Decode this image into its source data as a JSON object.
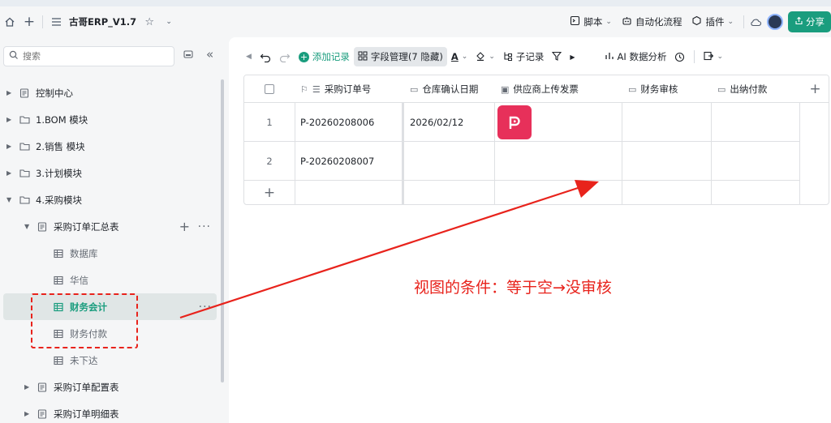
{
  "topbar": {
    "app_title": "古哥ERP_V1.7",
    "script_label": "脚本",
    "automation_label": "自动化流程",
    "plugin_label": "插件",
    "share_label": "分享"
  },
  "sidebar": {
    "search_placeholder": "搜索",
    "items": [
      {
        "label": "控制中心"
      },
      {
        "label": "1.BOM 模块"
      },
      {
        "label": "2.销售 模块"
      },
      {
        "label": "3.计划模块"
      },
      {
        "label": "4.采购模块"
      },
      {
        "label": "采购订单汇总表"
      },
      {
        "label": "数据库"
      },
      {
        "label": "华信"
      },
      {
        "label": "财务会计"
      },
      {
        "label": "财务付款"
      },
      {
        "label": "未下达"
      },
      {
        "label": "采购订单配置表"
      },
      {
        "label": "采购订单明细表"
      }
    ]
  },
  "toolbar": {
    "add_record": "添加记录",
    "field_manage": "字段管理(7 隐藏)",
    "sub_record": "子记录",
    "ai_analysis": "AI 数据分析"
  },
  "table": {
    "columns": [
      "采购订单号",
      "仓库确认日期",
      "供应商上传发票",
      "财务审核",
      "出纳付款"
    ],
    "rows": [
      {
        "num": "1",
        "order_no": "P-20260208006",
        "date": "2026/02/12",
        "has_attachment": true
      },
      {
        "num": "2",
        "order_no": "P-20260208007",
        "date": "",
        "has_attachment": false
      }
    ]
  },
  "annotation": {
    "text": "视图的条件：等于空→没审核",
    "color": "#e8231c"
  },
  "colors": {
    "accent": "#1a9d7e",
    "annotation": "#e8231c",
    "attachment_icon": "#e7305a"
  }
}
